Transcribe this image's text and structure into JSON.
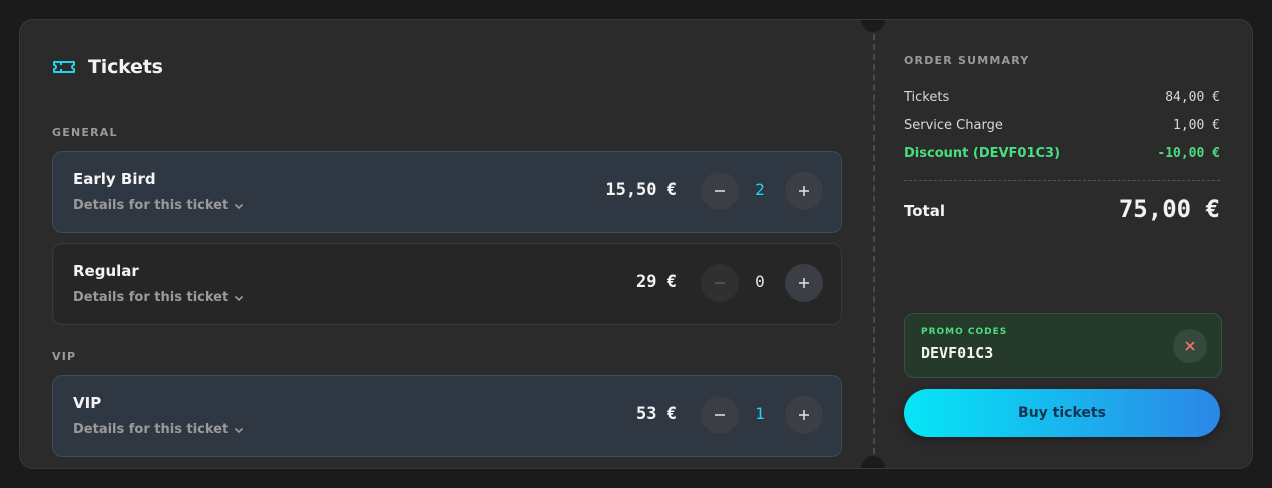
{
  "tickets_section": {
    "title": "Tickets",
    "icon": "ticket-icon",
    "accent_color": "#22d3ee",
    "groups": [
      {
        "label": "GENERAL",
        "tickets": [
          {
            "name": "Early Bird",
            "details": "Details for this ticket",
            "price": "15,50 €",
            "qty": "2"
          },
          {
            "name": "Regular",
            "details": "Details for this ticket",
            "price": "29 €",
            "qty": "0"
          }
        ]
      },
      {
        "label": "VIP",
        "tickets": [
          {
            "name": "VIP",
            "details": "Details for this ticket",
            "price": "53 €",
            "qty": "1"
          }
        ]
      }
    ]
  },
  "summary": {
    "title": "ORDER SUMMARY",
    "rows": [
      {
        "label": "Tickets",
        "value": "84,00 €"
      },
      {
        "label": "Service Charge",
        "value": "1,00 €"
      },
      {
        "label": "Discount (DEVF01C3)",
        "value": "-10,00 €"
      }
    ],
    "total_label": "Total",
    "total_value": "75,00 €",
    "discount_color": "#4ade80"
  },
  "promo": {
    "label": "PROMO CODES",
    "code": "DEVF01C3",
    "remove_icon": "close-icon"
  },
  "buy_button": {
    "label": "Buy tickets"
  }
}
